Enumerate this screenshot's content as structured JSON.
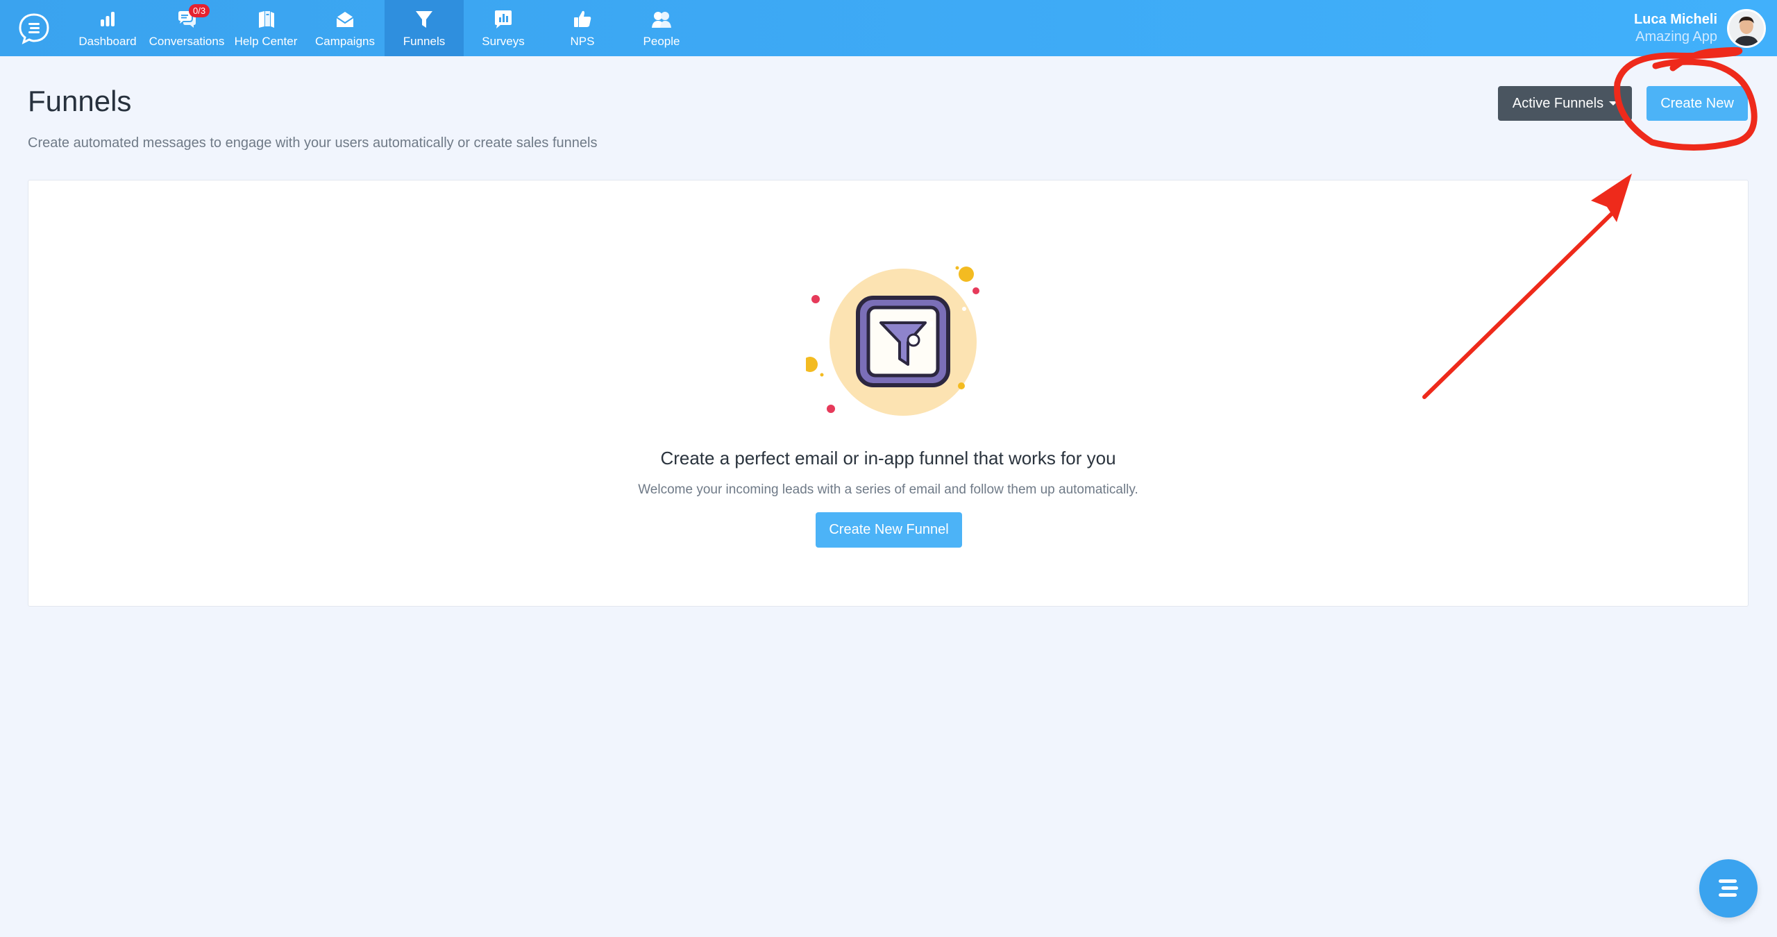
{
  "nav": {
    "items": [
      {
        "label": "Dashboard",
        "icon": "bar-chart-icon"
      },
      {
        "label": "Conversations",
        "icon": "chat-bubbles-icon",
        "badge": "0/3"
      },
      {
        "label": "Help Center",
        "icon": "books-icon"
      },
      {
        "label": "Campaigns",
        "icon": "envelope-icon"
      },
      {
        "label": "Funnels",
        "icon": "funnel-icon",
        "active": true
      },
      {
        "label": "Surveys",
        "icon": "survey-chart-icon"
      },
      {
        "label": "NPS",
        "icon": "thumbs-up-icon"
      },
      {
        "label": "People",
        "icon": "people-icon"
      }
    ]
  },
  "user": {
    "name": "Luca Micheli",
    "app": "Amazing App"
  },
  "page": {
    "title": "Funnels",
    "subtitle": "Create automated messages to engage with your users automatically or create sales funnels",
    "filter_button": "Active Funnels",
    "create_button": "Create New"
  },
  "empty_state": {
    "title": "Create a perfect email or in-app funnel that works for you",
    "description": "Welcome your incoming leads with a series of email and follow them up automatically.",
    "button": "Create New Funnel"
  },
  "colors": {
    "topbar": "#41b0fb",
    "active_tab": "#2f8fde",
    "primary_button": "#4cb3f7",
    "dark_button": "#4a5560",
    "annotation": "#ee2a1b",
    "badge": "#e5212f"
  }
}
